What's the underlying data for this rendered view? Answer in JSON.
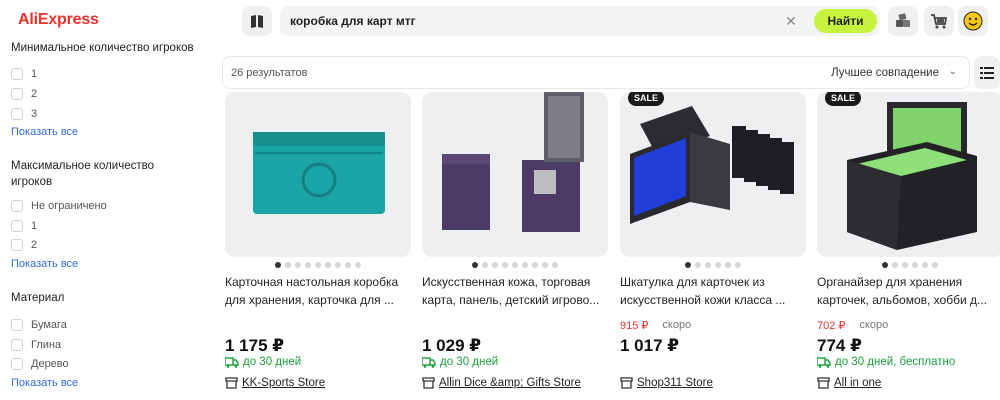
{
  "header": {
    "logo": "AliExpress",
    "search_value": "коробка для карт мтг",
    "search_button": "Найти"
  },
  "sidebar": {
    "min_players": {
      "title": "Минимальное количество игроков",
      "options": [
        "1",
        "2",
        "3"
      ],
      "show_all": "Показать все"
    },
    "max_players": {
      "title": "Максимальное количество игроков",
      "options": [
        "Не ограничено",
        "1",
        "2"
      ],
      "show_all": "Показать все"
    },
    "material": {
      "title": "Материал",
      "options": [
        "Бумага",
        "Глина",
        "Дерево"
      ],
      "show_all": "Показать все"
    }
  },
  "toolbar": {
    "results": "26 результатов",
    "sort": "Лучшее совпадение"
  },
  "products": [
    {
      "title_line1": "Карточная настольная коробка",
      "title_line2": "для хранения, карточка для ...",
      "old_price": "",
      "soon": "",
      "price": "1 175 ₽",
      "delivery": "до 30 дней",
      "store": "KK-Sports Store",
      "sale": ""
    },
    {
      "title_line1": "Искусственная кожа, торговая",
      "title_line2": "карта, панель, детский игрово...",
      "old_price": "",
      "soon": "",
      "price": "1 029 ₽",
      "delivery": "до 30 дней",
      "store": "Allin Dice &amp; Gifts Store",
      "sale": ""
    },
    {
      "title_line1": "Шкатулка для карточек из",
      "title_line2": "искусственной кожи класса ...",
      "old_price": "915 ₽",
      "soon": "скоро",
      "price": "1 017 ₽",
      "delivery": "",
      "store": "Shop311 Store",
      "sale": "SALE"
    },
    {
      "title_line1": "Органайзер для хранения",
      "title_line2": "карточек, альбомов, хобби д...",
      "old_price": "702 ₽",
      "soon": "скоро",
      "price": "774 ₽",
      "delivery": "до 30 дней, бесплатно",
      "store": "All in one",
      "sale": "SALE"
    }
  ],
  "colors": {
    "brand": "#e8322c",
    "search_button": "#c7f33e",
    "link": "#2f6ad9",
    "delivery": "#1a9e3f"
  }
}
